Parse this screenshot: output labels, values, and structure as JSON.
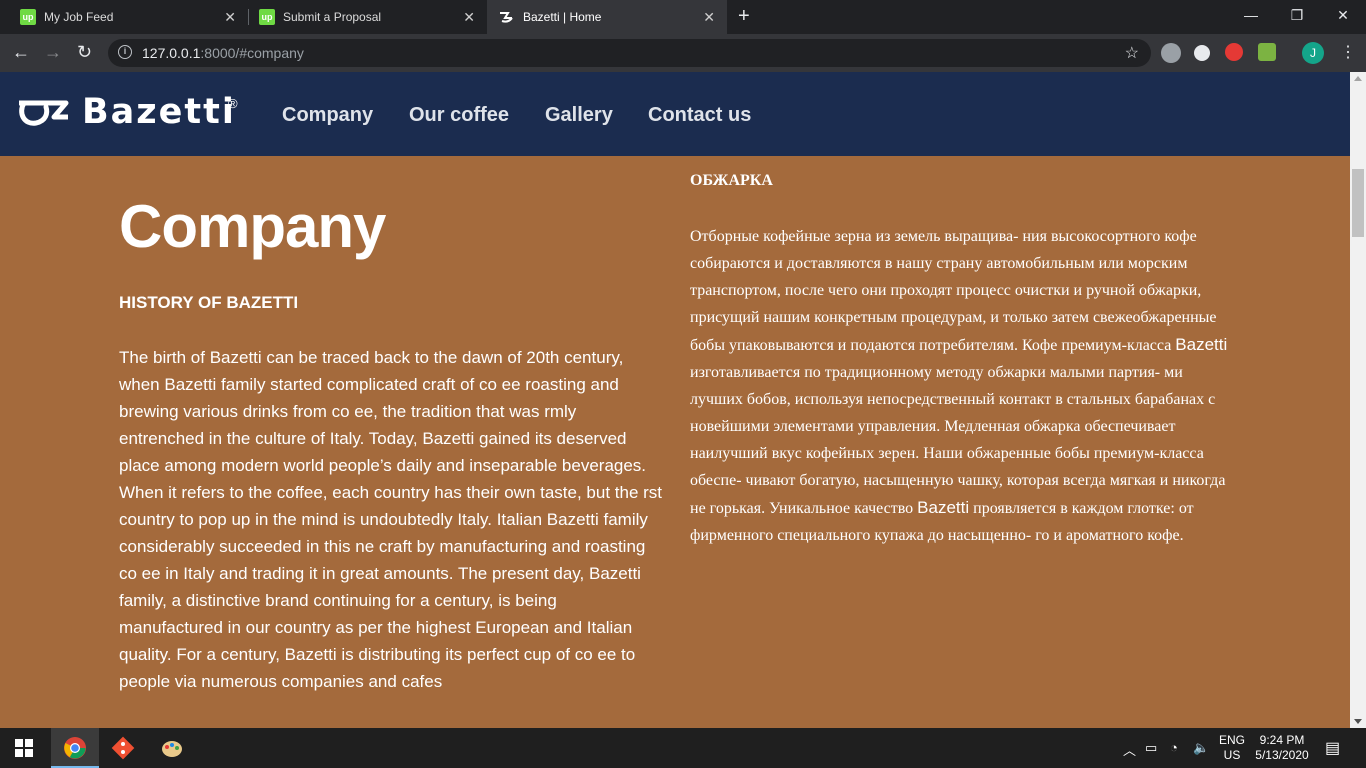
{
  "browser": {
    "tabs": [
      {
        "title": "My Job Feed",
        "favicon": "upwork-icon"
      },
      {
        "title": "Submit a Proposal",
        "favicon": "upwork-icon"
      },
      {
        "title": "Bazetti | Home",
        "favicon": "bazetti-icon",
        "active": true
      }
    ],
    "favicon_text": "up",
    "new_tab": "+",
    "window_controls": {
      "minimize": "—",
      "maximize": "❐",
      "close": "✕"
    },
    "url_host": "127.0.0.1",
    "url_rest": ":8000/#company",
    "profile_initial": "J"
  },
  "site": {
    "logo_text": "Bazetti",
    "logo_reg": "®",
    "nav": [
      "Company",
      "Our coffee",
      "Gallery",
      "Contact us"
    ]
  },
  "company": {
    "title": "Company",
    "subtitle": "HISTORY OF BAZETTI",
    "paragraph": "The birth of Bazetti can be traced back to the dawn of 20th century, when Bazetti family started complicated craft of co ee roasting and brewing various drinks from co ee, the tradition that was rmly entrenched in the culture of Italy. Today, Bazetti gained its deserved place among modern world people’s daily and inseparable beverages. When it refers to the coffee, each country has their own taste, but the rst country to pop up in the mind is undoubtedly Italy. Italian Bazetti family considerably succeeded in this ne craft by manufacturing and roasting co ee in Italy and trading it in great amounts. The present day, Bazetti family, a distinctive brand continuing for a century, is being manufactured in our country as per the highest European and Italian quality. For a century, Bazetti is distributing its perfect cup of co ee to people via numerous companies and cafes"
  },
  "roasting": {
    "title": "ОБЖАРКА",
    "part1": "Отборные кофейные зерна из земель выращива- ния высокосортного кофе собираются и доставляются в нашу страну автомобильным или морским транспортом, после чего они проходят процесс очистки и ручной обжарки, присущий нашим конкретным процедурам, и только затем свежеобжаренные бобы упаковываются и подаются потребителям. Кофе премиум-класса ",
    "brand1": "Bazetti",
    "part2": " изготавливается по традиционному методу обжарки малыми партия- ми лучших бобов, используя непосредственный контакт в стальных барабанах с новейшими элементами управления. Медленная обжарка обеспечивает наилучший вкус кофейных зерен. Наши обжаренные бобы премиум-класса обеспе- чивают богатую, насыщенную чашку, которая всегда мягкая и никогда не горькая. Уникальное качество ",
    "brand2": "Bazetti",
    "part3": " проявляется в каждом глотке: от фирменного специального купажа до насыщенно- го и ароматного кофе."
  },
  "taskbar": {
    "lang": "ENG",
    "region": "US",
    "time": "9:24 PM",
    "date": "5/13/2020"
  },
  "colors": {
    "page_bg": "#a46a3c",
    "header_bg": "#1b2c4f",
    "upwork_green": "#6fda44"
  }
}
